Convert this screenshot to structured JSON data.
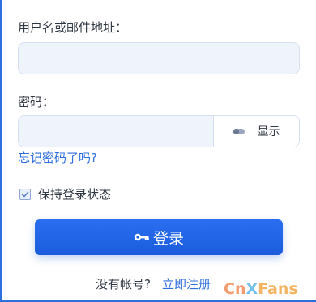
{
  "form": {
    "username_label": "用户名或邮件地址：",
    "username_value": "",
    "password_label": "密码：",
    "password_value": "",
    "show_label": "显示",
    "forgot_link": "忘记密码了吗?",
    "remember_label": "保持登录状态",
    "remember_checked": true,
    "login_label": "登录",
    "no_account_text": "没有帐号?",
    "register_link": "立即注册"
  },
  "watermark": {
    "c": "Cn",
    "x": "X",
    "f": "Fans"
  },
  "colors": {
    "accent": "#2f6fdd",
    "button": "#1f63e6",
    "input_bg": "#eff3fb"
  }
}
